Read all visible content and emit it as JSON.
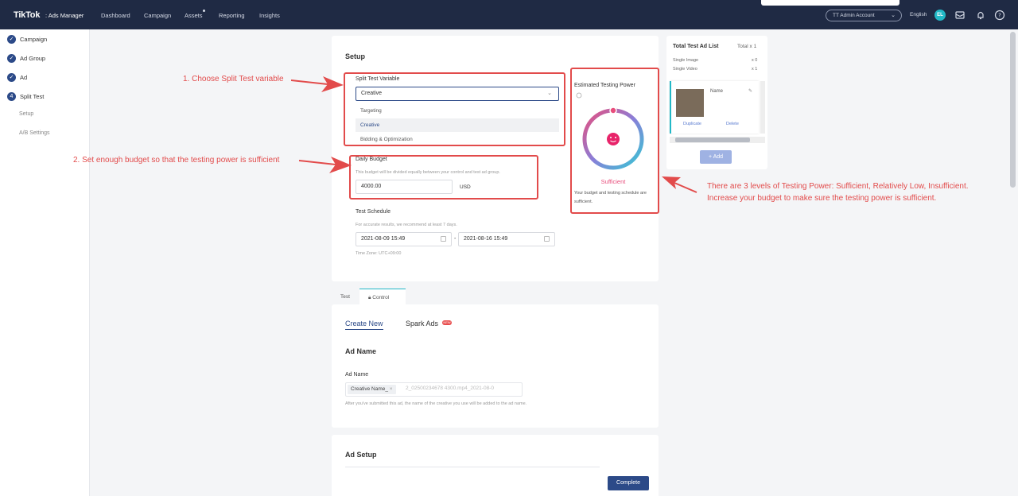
{
  "nav": {
    "logo": "TikTok",
    "logo_sub": ": Ads Manager",
    "items": [
      "Dashboard",
      "Campaign",
      "Assets",
      "Reporting",
      "Insights"
    ],
    "account": "TT Admin Account",
    "language": "English",
    "avatar": "EL"
  },
  "sidebar": {
    "steps": [
      {
        "label": "Campaign",
        "mark": "✓"
      },
      {
        "label": "Ad Group",
        "mark": "✓"
      },
      {
        "label": "Ad",
        "mark": "✓"
      },
      {
        "label": "Split Test",
        "mark": "4"
      }
    ],
    "substeps": [
      "Setup",
      "A/B Settings"
    ]
  },
  "setup": {
    "title": "Setup",
    "variable_label": "Split Test Variable",
    "variable_value": "Creative",
    "options": [
      "Targeting",
      "Creative",
      "Bidding & Optimization"
    ],
    "budget_label": "Daily Budget",
    "budget_hint": "This budget will be divided equally between your control and test ad group.",
    "budget_value": "4000.00",
    "budget_currency": "USD",
    "schedule_label": "Test Schedule",
    "schedule_hint": "For accurate results, we recommend at least 7 days.",
    "start": "2021-08-09 15:49",
    "end": "2021-08-16 15:49",
    "dash": "-",
    "timezone": "Time Zone: UTC+09:00"
  },
  "testing_power": {
    "title": "Estimated Testing Power",
    "level": "Sufficient",
    "desc": "Your budget and testing schedule are sufficient."
  },
  "ad_list": {
    "title": "Total Test Ad List",
    "total": "Total x 1",
    "rows": [
      {
        "label": "Single Image",
        "value": "x 0"
      },
      {
        "label": "Single Video",
        "value": "x 1"
      }
    ],
    "card_name": "Name",
    "duplicate": "Duplicate",
    "delete": "Delete",
    "add": "+ Add"
  },
  "tabs": [
    "Test",
    "Control"
  ],
  "creative_tabs": [
    "Create New",
    "Spark Ads"
  ],
  "new_badge": "NEW",
  "ad_name": {
    "section": "Ad Name",
    "label": "Ad Name",
    "tag": "Creative Name_",
    "tag_close": "×",
    "ghost": "2_02500234678 4300.mp4_2021-08-0",
    "hint": "After you've submitted this ad, the name of the creative you use will be added to the ad name."
  },
  "ad_setup": {
    "section": "Ad Setup"
  },
  "complete": "Complete",
  "annotations": {
    "a1": "1. Choose Split Test variable",
    "a2": "2. Set enough budget so that the testing power is sufficient",
    "a3_line1": "There are 3 levels of Testing Power: Sufficient, Relatively Low, Insufficient.",
    "a3_line2": "Increase your budget to make sure the testing power is sufficient."
  }
}
